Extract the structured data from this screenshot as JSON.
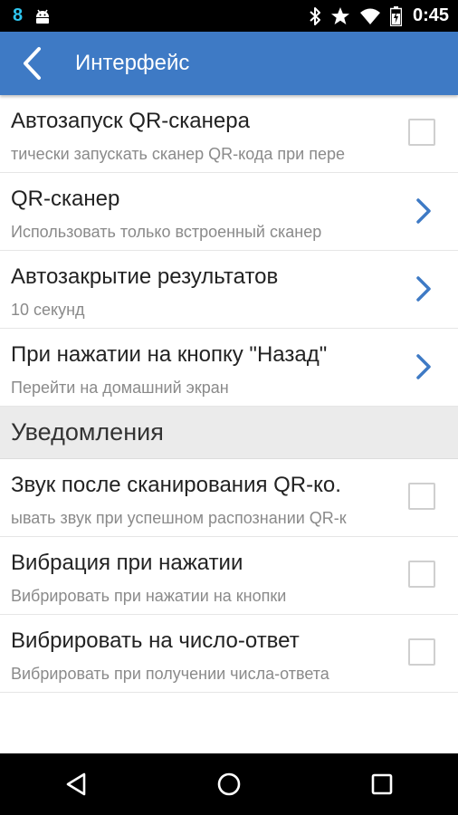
{
  "status_bar": {
    "notification_badge": "8",
    "time": "0:45",
    "icons": [
      "android-debug-icon",
      "bluetooth-icon",
      "star-icon",
      "wifi-icon",
      "battery-icon"
    ]
  },
  "app_bar": {
    "title": "Интерфейс"
  },
  "interface_settings": [
    {
      "title": "Автозапуск QR-сканера",
      "subtitle": "тически запускать сканер QR-кода при пере",
      "control": "checkbox",
      "checked": false
    },
    {
      "title": "QR-сканер",
      "subtitle": "Использовать только встроенный сканер",
      "control": "chevron"
    },
    {
      "title": "Автозакрытие результатов",
      "subtitle": "10 секунд",
      "control": "chevron"
    },
    {
      "title": "При нажатии на кнопку \"Назад\"",
      "subtitle": "Перейти на домашний экран",
      "control": "chevron"
    }
  ],
  "notifications_section": {
    "title": "Уведомления",
    "items": [
      {
        "title": "Звук после сканирования QR-ко.",
        "subtitle": "ывать звук при успешном распознании QR-к",
        "control": "checkbox",
        "checked": false
      },
      {
        "title": "Вибрация при нажатии",
        "subtitle": "Вибрировать при нажатии на кнопки",
        "control": "checkbox",
        "checked": false
      },
      {
        "title": "Вибрировать на число-ответ",
        "subtitle": "Вибрировать при получении числа-ответа",
        "control": "checkbox",
        "checked": false
      }
    ]
  },
  "colors": {
    "app_bar": "#3e7ac5",
    "chevron": "#3e7ac5",
    "status_badge": "#2ec5ef",
    "section_bg": "#ebebeb"
  },
  "nav_bar": {
    "buttons": [
      "back-triangle-icon",
      "home-circle-icon",
      "recents-square-icon"
    ]
  }
}
